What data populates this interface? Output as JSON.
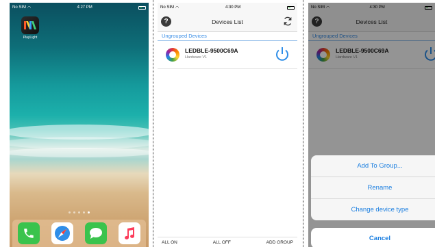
{
  "home": {
    "status": {
      "carrier": "No SIM",
      "time": "4:27 PM"
    },
    "app": {
      "label": "PlayLight",
      "icon": "playlight-app-icon"
    },
    "dock": [
      {
        "name": "phone-app-icon",
        "color": "#3ac34d"
      },
      {
        "name": "safari-app-icon",
        "color": "#ffffff"
      },
      {
        "name": "messages-app-icon",
        "color": "#3ac34d"
      },
      {
        "name": "music-app-icon",
        "color": "#ffffff"
      }
    ]
  },
  "devices_screen": {
    "status": {
      "carrier": "No SIM",
      "time": "4:30 PM"
    },
    "title": "Devices List",
    "section": "Ungrouped Devices",
    "device": {
      "name": "LEDBLE-9500C69A",
      "subtitle": "Hardware V1"
    },
    "bottom": {
      "all_on": "ALL ON",
      "all_off": "ALL OFF",
      "add_group": "ADD GROUP"
    }
  },
  "action_screen": {
    "status": {
      "carrier": "No SIM",
      "time": "4:30 PM"
    },
    "title": "Devices List",
    "section": "Ungrouped Devices",
    "device": {
      "name": "LEDBLE-9500C69A",
      "subtitle": "Hardware V1"
    },
    "sheet": {
      "add_to_group": "Add To Group...",
      "rename": "Rename",
      "change_type": "Change device type",
      "cancel": "Cancel"
    }
  },
  "colors": {
    "accent": "#1c7fe0",
    "section": "#3a8ee6"
  }
}
